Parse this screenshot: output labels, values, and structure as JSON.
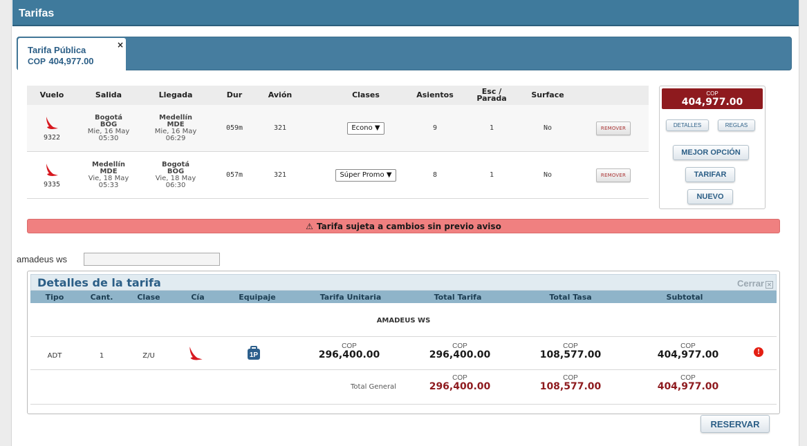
{
  "header": {
    "title": "Tarifas"
  },
  "tab": {
    "title": "Tarifa Pública",
    "currency": "COP",
    "amount": "404,977.00",
    "close": "×"
  },
  "flights": {
    "columns": {
      "vuelo": "Vuelo",
      "salida": "Salida",
      "llegada": "Llegada",
      "dur": "Dur",
      "avion": "Avión",
      "clases": "Clases",
      "asientos": "Asientos",
      "esc_line1": "Esc /",
      "esc_line2": "Parada",
      "surface": "Surface"
    },
    "rows": [
      {
        "flight_number": "9322",
        "dep_city": "Bogotá",
        "dep_code": "BOG",
        "dep_date": "Mie, 16 May",
        "dep_time": "05:30",
        "arr_city": "Medellín",
        "arr_code": "MDE",
        "arr_date": "Mie, 16 May",
        "arr_time": "06:29",
        "duration": "059m",
        "aircraft": "321",
        "class": "Econo ▼",
        "seats": "9",
        "stops": "1",
        "surface": "No",
        "remove_label": "REMOVER"
      },
      {
        "flight_number": "9335",
        "dep_city": "Medellín",
        "dep_code": "MDE",
        "dep_date": "Vie, 18 May",
        "dep_time": "05:33",
        "arr_city": "Bogotá",
        "arr_code": "BOG",
        "arr_date": "Vie, 18 May",
        "arr_time": "06:30",
        "duration": "057m",
        "aircraft": "321",
        "class": "Súper Promo ▼",
        "seats": "8",
        "stops": "1",
        "surface": "No",
        "remove_label": "REMOVER"
      }
    ]
  },
  "summary": {
    "currency": "COP",
    "amount": "404,977.00",
    "details_label": "DETALLES",
    "rules_label": "REGLAS",
    "best_option_label": "MEJOR OPCIÓN",
    "price_label": "TARIFAR",
    "new_label": "NUEVO"
  },
  "warning": {
    "icon": "⚠",
    "text": "Tarifa sujeta a cambios sin previo aviso"
  },
  "provider": {
    "label": "amadeus ws",
    "value": ""
  },
  "details": {
    "title": "Detalles de la tarifa",
    "close_label": "Cerrar",
    "close_icon": "☒",
    "columns": {
      "tipo": "Tipo",
      "cant": "Cant.",
      "clase": "Clase",
      "cia": "Cía",
      "equipaje": "Equipaje",
      "tarifa_unitaria": "Tarifa Unitaria",
      "total_tarifa": "Total Tarifa",
      "total_tasa": "Total Tasa",
      "subtotal": "Subtotal"
    },
    "provider_name": "AMADEUS WS",
    "row": {
      "tipo": "ADT",
      "cant": "1",
      "clase": "Z/U",
      "baggage": "1P",
      "currency": "COP",
      "tarifa_unitaria": "296,400.00",
      "total_tarifa": "296,400.00",
      "total_tasa": "108,577.00",
      "subtotal": "404,977.00"
    },
    "total": {
      "label": "Total General",
      "currency": "COP",
      "total_tarifa": "296,400.00",
      "total_tasa": "108,577.00",
      "subtotal": "404,977.00"
    }
  },
  "actions": {
    "reserve_label": "RESERVAR"
  },
  "colors": {
    "header_blue": "#3f7a9c",
    "price_red": "#8e1a1e",
    "warning_bg": "#f08080",
    "link_blue": "#2b5e86",
    "airline_red": "#d71920"
  }
}
